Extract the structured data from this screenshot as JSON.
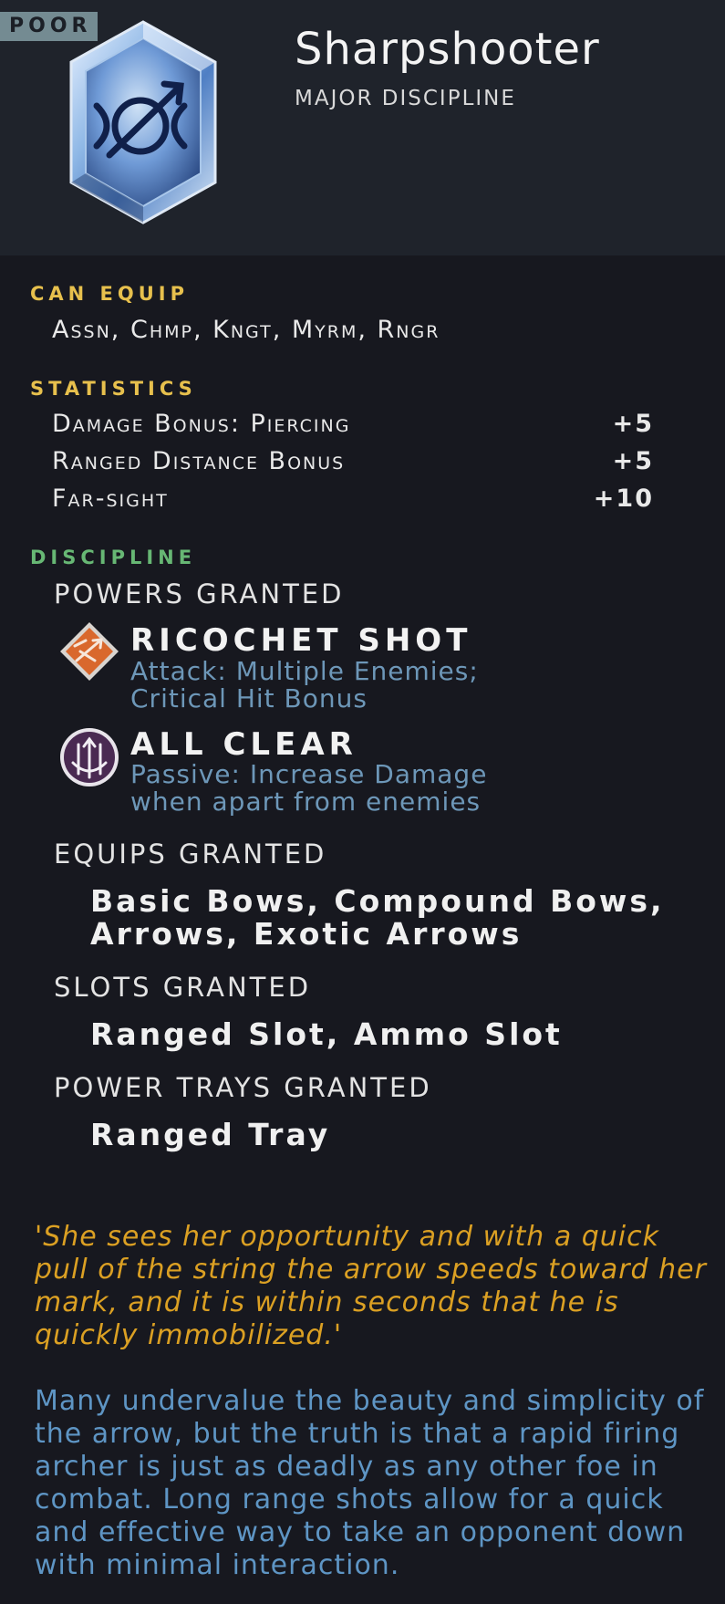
{
  "header": {
    "rarity": "POOR",
    "title": "Sharpshooter",
    "subtitle": "MAJOR DISCIPLINE",
    "gem_icon": "bow-crosshair-gem-icon"
  },
  "can_equip": {
    "label": "CAN EQUIP",
    "classes": "Assn, Chmp, Kngt, Myrm, Rngr"
  },
  "statistics": {
    "label": "STATISTICS",
    "rows": [
      {
        "name": "Damage Bonus: Piercing",
        "value": "+5"
      },
      {
        "name": "Ranged Distance Bonus",
        "value": "+5"
      },
      {
        "name": "Far-sight",
        "value": "+10"
      }
    ]
  },
  "discipline": {
    "label": "DISCIPLINE",
    "powers_heading": "POWERS GRANTED",
    "powers": [
      {
        "icon": "ricochet-arrow-icon",
        "name": "RICOCHET SHOT",
        "desc1": "Attack: Multiple Enemies;",
        "desc2": "Critical Hit Bonus"
      },
      {
        "icon": "all-clear-arrows-icon",
        "name": "ALL CLEAR",
        "desc1": "Passive: Increase Damage",
        "desc2": "when apart from enemies"
      }
    ],
    "equips_heading": "EQUIPS GRANTED",
    "equips_line1": "Basic Bows, Compound Bows,",
    "equips_line2": "Arrows, Exotic Arrows",
    "slots_heading": "SLOTS GRANTED",
    "slots": "Ranged Slot, Ammo Slot",
    "trays_heading": "POWER TRAYS GRANTED",
    "trays": "Ranged Tray"
  },
  "flavor": {
    "quote_open": "'",
    "quote": "She sees her opportunity and with a quick pull of the string the arrow speeds toward her mark, and it is within seconds that he is quickly immobilized.",
    "quote_close": "'",
    "lore": "Many undervalue the beauty and simplicity of the arrow, but the truth is that a rapid firing archer is just as deadly as any other foe in combat. Long range shots allow for a quick and effective way to take an opponent down with minimal interaction."
  },
  "colors": {
    "background": "#17181f",
    "header_bg": "#1f232b",
    "section_gold": "#e7c04d",
    "section_green": "#67b774",
    "power_desc": "#6d97b8",
    "quote": "#dba023",
    "lore": "#5e95c4"
  }
}
